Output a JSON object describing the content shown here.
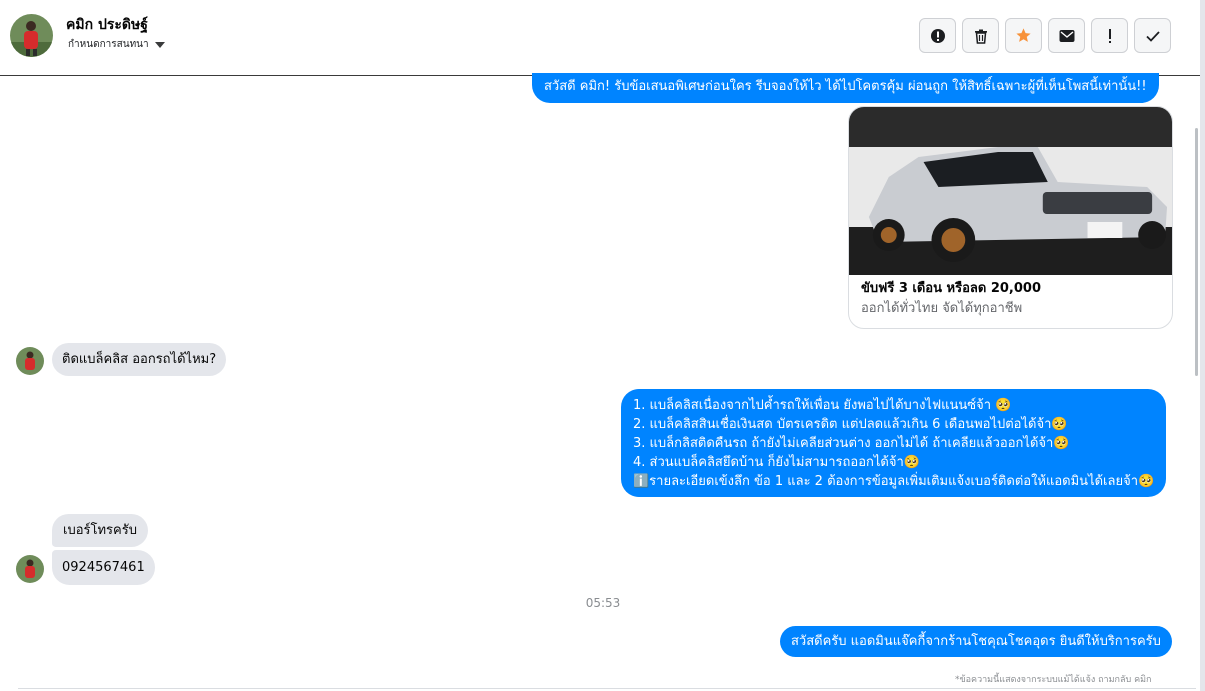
{
  "header": {
    "contact_name": "คมิก ประดิษฐ์",
    "conversation_setting": "กำหนดการสนทนา"
  },
  "toolbar": {
    "buttons": [
      "alert-circle-icon",
      "trash-icon",
      "star-icon",
      "envelope-icon",
      "exclamation-icon",
      "check-icon"
    ]
  },
  "messages": {
    "greeting": "สวัสดี คมิก! รับข้อเสนอพิเศษก่อนใคร รีบจองให้ไว ได้ไปโคตรคุ้ม ผ่อนถูก ให้สิทธิ์เฉพาะผู้ที่เห็นโพสนี้เท่านั้น!!",
    "card_title": "ขับฟรี 3 เดือน หรือลด 20,000",
    "card_subtitle": "ออกได้ทั่วไทย จัดได้ทุกอาชีพ",
    "customer_q1": "ติดแบล็คลิส ออกรถได้ไหม?",
    "reply_lines": [
      "1. แบล็คลิสเนื่องจากไปค้ำรถให้เพื่อน ยังพอไปได้บางไฟแนนซ์จ้า 🥺",
      "2. แบล็คลิสสินเชื่อเงินสด บัตรเครดิต แต่ปลดแล้วเกิน 6 เดือนพอไปต่อได้จ้า🥺",
      "3. แบล็กลิสติดคืนรถ ถ้ายังไม่เคลียส่วนต่าง ออกไม่ได้ ถ้าเคลียแล้วออกได้จ้า🥺",
      "4. ส่วนแบล็คลิสยึดบ้าน ก็ยังไม่สามารถออกได้จ้า🥺",
      "ℹ️รายละเอียดเข้งลึก ข้อ 1 และ 2 ต้องการข้อมูลเพิ่มเติมแจ้งเบอร์ติดต่อให้แอดมินได้เลยจ้า🥺"
    ],
    "customer_q2": "เบอร์โทรครับ",
    "customer_phone": "0924567461",
    "timestamp": "05:53",
    "final_reply": "สวัสดีครับ แอดมินแจ๊คกี้จากร้านโชคุณโชคอุดร ยินดีให้บริการครับ",
    "footnote": "*ข้อความนี้แสดงจากระบบแม้ได้แจ้ง ถามกลับ คมิก"
  },
  "colors": {
    "outgoing_bubble": "#0084ff",
    "incoming_bubble": "#e4e6eb",
    "star_accent": "#f7923a"
  }
}
